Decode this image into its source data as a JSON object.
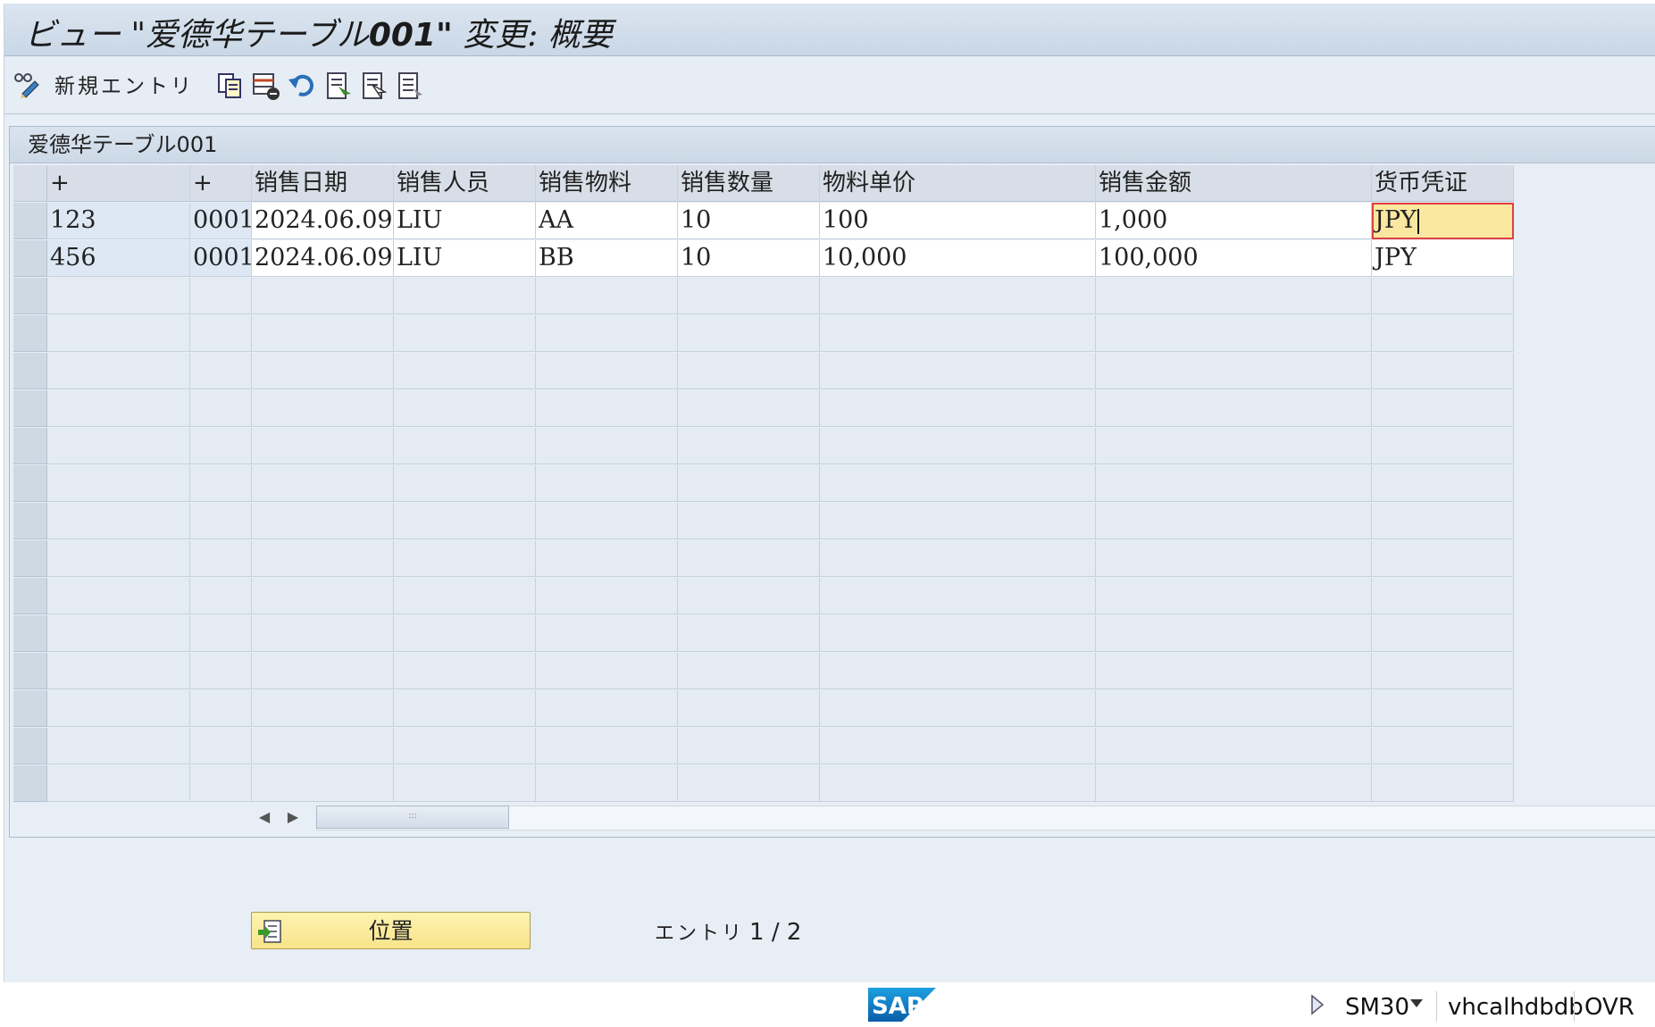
{
  "window": {
    "title_prefix": "ビュー \"爱德华テーブル",
    "title_bold": "001\"",
    "title_suffix": " 変更: 概要"
  },
  "toolbar": {
    "new_entries_label": "新規エントリ",
    "icons": [
      "edit-glasses-icon",
      "copy-icon",
      "delete-icon",
      "undo-icon",
      "select-all-icon",
      "select-block-icon",
      "deselect-all-icon"
    ]
  },
  "panel": {
    "title": "爱德华テーブル001"
  },
  "table": {
    "columns": [
      "+",
      "+",
      "销售日期",
      "销售人员",
      "销售物料",
      "销售数量",
      "物料单价",
      "销售金额",
      "货币凭证"
    ],
    "rows": [
      [
        "123",
        "0001",
        "2024.06.09",
        "LIU",
        "AA",
        "10",
        "100",
        "1,000",
        "JPY"
      ],
      [
        "456",
        "0001",
        "2024.06.09",
        "LIU",
        "BB",
        "10",
        "10,000",
        "100,000",
        "JPY"
      ]
    ],
    "empty_rows": 14
  },
  "footer": {
    "position_button": "位置",
    "entry_label": "エントリ",
    "entry_count": "1 / 2"
  },
  "status": {
    "transaction": "SM30",
    "system": "vhcalhdbdb",
    "mode": "OVR"
  },
  "colors": {
    "title_bg": "#c9d7e6",
    "focus_cell": "#fbe8a0",
    "button_yellow": "#f7e48a"
  }
}
